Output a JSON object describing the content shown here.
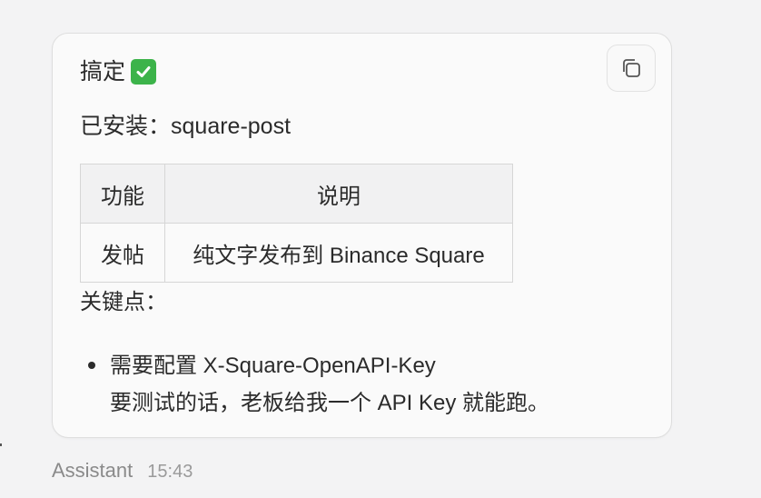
{
  "message": {
    "title": "搞定",
    "check_icon": "white-heavy-check-mark-emoji",
    "installed_label": "已安装：",
    "installed_value": "square-post",
    "table": {
      "headers": [
        "功能",
        "说明"
      ],
      "rows": [
        [
          "发帖",
          "纯文字发布到 Binance Square"
        ]
      ]
    },
    "keypoints_label": "关键点：",
    "bullets": [
      {
        "line1": "需要配置 X-Square-OpenAPI-Key",
        "line2": "要测试的话，老板给我一个 API Key 就能跑。"
      }
    ]
  },
  "copy_button": {
    "icon": "copy-icon"
  },
  "meta": {
    "sender": "Assistant",
    "time": "15:43"
  },
  "colors": {
    "check_green": "#3cb34a",
    "bubble_bg": "#fafafa",
    "page_bg": "#f3f3f4"
  }
}
